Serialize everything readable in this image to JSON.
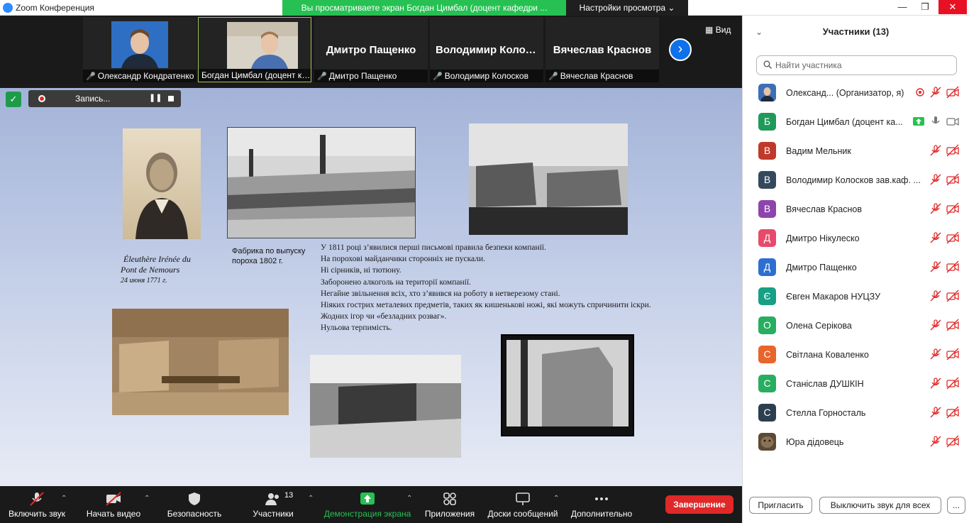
{
  "window": {
    "app_title": "Zoom Конференция",
    "share_banner": "Вы просматриваете экран Богдан Цимбал (доцент кафедри ...",
    "view_options": "Настройки просмотра",
    "minimize": "—",
    "maximize": "❐",
    "close": "✕"
  },
  "video_strip": {
    "tiles": [
      {
        "name": "Олександр Кондратенко",
        "big_name": ""
      },
      {
        "name": "Богдан Цимбал (доцент кафедри)",
        "big_name": ""
      },
      {
        "name": "Дмитро Пащенко",
        "big_name": "Дмитро Пащенко"
      },
      {
        "name": "Володимир Колосков",
        "big_name": "Володимир Колосков"
      },
      {
        "name": "Вячеслав Краснов",
        "big_name": "Вячеслав Краснов"
      }
    ],
    "view_label": "Вид"
  },
  "recording": {
    "label": "Запись..."
  },
  "slide": {
    "portrait_caption": {
      "line1": "Éleuthère Irénée du",
      "line2": "Pont de Nemours",
      "date": "24 июня 1771 г."
    },
    "factory_caption": "Фабрика по выпуску пороха 1802 г.",
    "rules": [
      "У 1811 році з’явилися перші письмові правила безпеки компанії.",
      "На порохові майданчики сторонніх не пускали.",
      "Ні сірників, ні тютюну.",
      "Заборонено алкоголь на території компанії.",
      "Негайне звільнення всіх, хто з’явився на роботу в нетверезому стані.",
      "Ніяких гострих металевих предметів, таких як кишенькові ножі, які можуть спричинити іскри.",
      "Жодних ігор чи «безладних розваг».",
      "Нульова терпимість."
    ]
  },
  "toolbar": {
    "unmute": "Включить звук",
    "start_video": "Начать видео",
    "security": "Безопасность",
    "participants": "Участники",
    "participants_count": "13",
    "share_screen": "Демонстрация экрана",
    "apps": "Приложения",
    "whiteboards": "Доски сообщений",
    "more": "Дополнительно",
    "end": "Завершение"
  },
  "panel": {
    "title": "Участники (13)",
    "search_placeholder": "Найти участника",
    "participants": [
      {
        "initial": "",
        "name": "Олександ...  (Организатор, я)",
        "color": "#3b6fb6"
      },
      {
        "initial": "Б",
        "name": "Богдан Цимбал (доцент ка...",
        "color": "#1f9a5a"
      },
      {
        "initial": "В",
        "name": "Вадим Мельник",
        "color": "#c0392b"
      },
      {
        "initial": "В",
        "name": "Володимир Колосков зав.каф. ...",
        "color": "#34495e"
      },
      {
        "initial": "В",
        "name": "Вячеслав Краснов",
        "color": "#8e44ad"
      },
      {
        "initial": "Д",
        "name": "Дмитро Нікулеско",
        "color": "#e84a6b"
      },
      {
        "initial": "Д",
        "name": "Дмитро Пащенко",
        "color": "#2d6fd1"
      },
      {
        "initial": "Є",
        "name": "Євген Макаров НУЦЗУ",
        "color": "#16a085"
      },
      {
        "initial": "О",
        "name": "Олена Серікова",
        "color": "#27ae60"
      },
      {
        "initial": "С",
        "name": "Світлана Коваленко",
        "color": "#e8652c"
      },
      {
        "initial": "С",
        "name": "Станіслав ДУШКІН",
        "color": "#27ae60"
      },
      {
        "initial": "С",
        "name": "Стелла Горносталь",
        "color": "#2c3e50"
      },
      {
        "initial": "",
        "name": "Юра дідовець",
        "color": "#5d4a36"
      }
    ],
    "invite": "Пригласить",
    "mute_all": "Выключить звук для всех",
    "more": "..."
  },
  "colors": {
    "accent_blue": "#0e71eb",
    "share_green": "#26c152",
    "end_red": "#e02828",
    "muted_red": "#e02828"
  }
}
